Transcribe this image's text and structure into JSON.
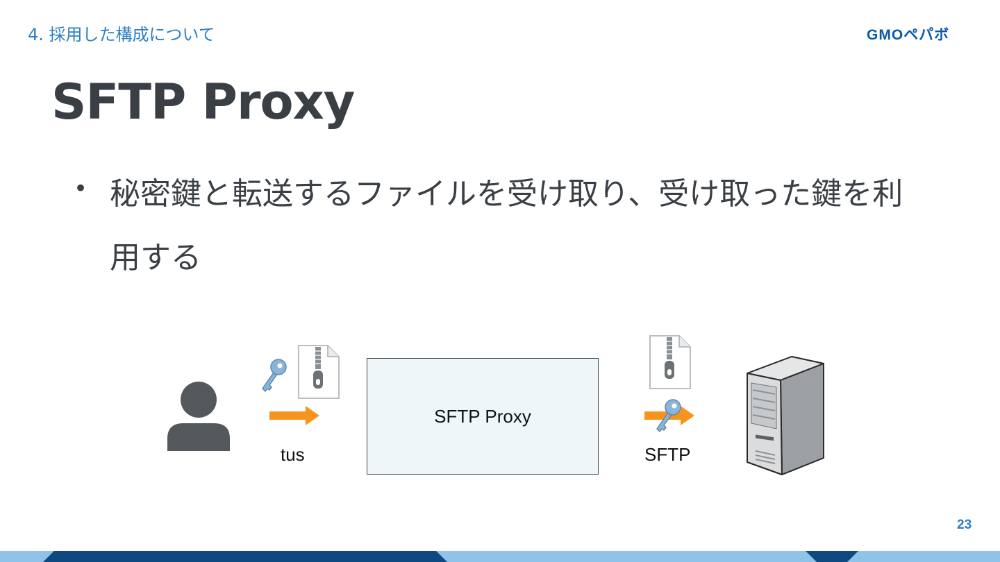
{
  "header": {
    "section": "4. 採用した構成について",
    "logo": "GMOペパボ"
  },
  "slide": {
    "title": "SFTP Proxy",
    "bullets": [
      {
        "text": "秘密鍵と転送するファイルを受け取り、受け取った鍵を利用する"
      }
    ],
    "page_number": "23"
  },
  "diagram": {
    "proxy_label": "SFTP Proxy",
    "left_protocol": "tus",
    "right_protocol": "SFTP",
    "icons": {
      "user": "user-icon",
      "key": "key-icon",
      "zip": "zip-file-icon",
      "arrow": "arrow-right-icon",
      "server": "server-icon"
    },
    "colors": {
      "arrow": "#f7941d",
      "proxy_fill": "#eff6f9",
      "accent": "#2f7fc4",
      "footer_dark": "#0e4a80",
      "footer_light": "#8fc3e8"
    }
  }
}
